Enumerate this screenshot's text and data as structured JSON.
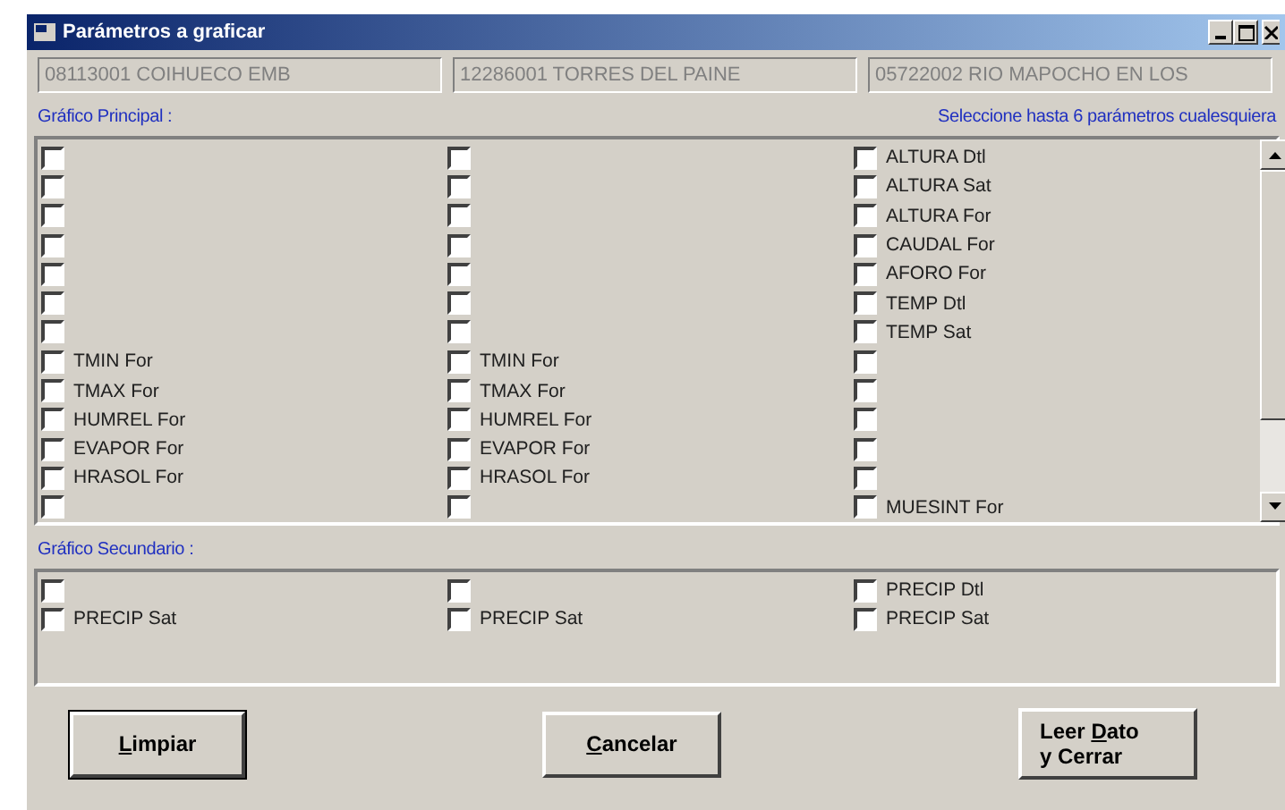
{
  "window": {
    "title": "Parámetros  a graficar"
  },
  "stations": [
    "08113001  COIHUECO EMB",
    "12286001  TORRES DEL PAINE",
    "05722002  RIO MAPOCHO EN LOS"
  ],
  "principal": {
    "label": "Gráfico Principal :",
    "hint": "Seleccione hasta 6 parámetros cualesquiera",
    "columns": [
      [
        {
          "checked": false
        },
        {
          "checked": false
        },
        {
          "checked": false
        },
        {
          "checked": false
        },
        {
          "checked": false
        },
        {
          "checked": false
        },
        {
          "checked": false
        },
        {
          "label": "TMIN For",
          "checked": false
        },
        {
          "label": "TMAX For",
          "checked": false
        },
        {
          "label": "HUMREL For",
          "checked": false
        },
        {
          "label": "EVAPOR For",
          "checked": false
        },
        {
          "label": "HRASOL For",
          "checked": false
        },
        {
          "checked": false
        }
      ],
      [
        {
          "checked": false
        },
        {
          "checked": false
        },
        {
          "checked": false
        },
        {
          "checked": false
        },
        {
          "checked": false
        },
        {
          "checked": false
        },
        {
          "checked": false
        },
        {
          "label": "TMIN For",
          "checked": false
        },
        {
          "label": "TMAX For",
          "checked": false
        },
        {
          "label": "HUMREL For",
          "checked": false
        },
        {
          "label": "EVAPOR For",
          "checked": false
        },
        {
          "label": "HRASOL For",
          "checked": false
        },
        {
          "checked": false
        }
      ],
      [
        {
          "label": "ALTURA Dtl",
          "checked": false
        },
        {
          "label": "ALTURA Sat",
          "checked": false
        },
        {
          "label": "ALTURA For",
          "checked": false
        },
        {
          "label": "CAUDAL For",
          "checked": false
        },
        {
          "label": "AFORO For",
          "checked": false
        },
        {
          "label": "TEMP Dtl",
          "checked": false
        },
        {
          "label": "TEMP Sat",
          "checked": false
        },
        {
          "checked": false
        },
        {
          "checked": false
        },
        {
          "checked": false
        },
        {
          "checked": false
        },
        {
          "checked": false
        },
        {
          "label": "MUESINT For",
          "checked": false
        }
      ]
    ]
  },
  "secundario": {
    "label": "Gráfico Secundario :",
    "columns": [
      [
        {
          "checked": false
        },
        {
          "label": "PRECIP Sat",
          "checked": false
        }
      ],
      [
        {
          "checked": false
        },
        {
          "label": "PRECIP Sat",
          "checked": false
        }
      ],
      [
        {
          "label": "PRECIP Dtl",
          "checked": false
        },
        {
          "label": "PRECIP Sat",
          "checked": false
        }
      ]
    ]
  },
  "buttons": [
    {
      "focused": true,
      "lines": [
        [
          {
            "text": "L",
            "underlined": true
          },
          {
            "text": "impiar",
            "underlined": false
          }
        ]
      ]
    },
    {
      "focused": false,
      "lines": [
        [
          {
            "text": "C",
            "underlined": true
          },
          {
            "text": "ancelar",
            "underlined": false
          }
        ]
      ]
    },
    {
      "focused": false,
      "lines": [
        [
          {
            "text": "Leer ",
            "underlined": false
          },
          {
            "text": "D",
            "underlined": true
          },
          {
            "text": "ato",
            "underlined": false
          }
        ],
        [
          {
            "text": "y Cerrar",
            "underlined": false
          }
        ]
      ]
    }
  ]
}
